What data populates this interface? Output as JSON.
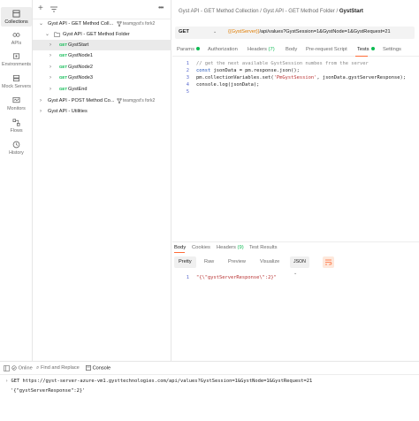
{
  "rail": [
    {
      "label": "Collections",
      "icon": "collections-icon",
      "active": true
    },
    {
      "label": "APIs",
      "icon": "apis-icon"
    },
    {
      "label": "Environments",
      "icon": "environments-icon"
    },
    {
      "label": "Mock Servers",
      "icon": "mock-servers-icon"
    },
    {
      "label": "Monitors",
      "icon": "monitors-icon"
    },
    {
      "label": "Flows",
      "icon": "flows-icon"
    },
    {
      "label": "History",
      "icon": "history-icon"
    }
  ],
  "sidebar": {
    "tree": [
      {
        "label": "Gyst API - GET Method Coll...",
        "fork": "teamgyst's fork2"
      },
      {
        "label": "Gyst API - GET Method Folder"
      },
      {
        "method": "GET",
        "label": "GystStart"
      },
      {
        "method": "GET",
        "label": "GystNode1"
      },
      {
        "method": "GET",
        "label": "GystNode2"
      },
      {
        "method": "GET",
        "label": "GystNode3"
      },
      {
        "method": "GET",
        "label": "GystEnd"
      },
      {
        "label": "Gyst API - POST Method Co...",
        "fork": "teamgyst's fork2"
      },
      {
        "label": "Gyst API - Utilities"
      }
    ]
  },
  "breadcrumb": {
    "part1": "Gyst API - GET Method Collection",
    "sep": "/",
    "part2": "Gyst API - GET Method Folder",
    "current": "GystStart"
  },
  "request": {
    "method": "GET",
    "url_var": "{{GystServer}}",
    "url_rest": "/api/values?GystSession=1&GystNode=1&GystRequest=21"
  },
  "tabs": {
    "params": "Params",
    "authorization": "Authorization",
    "headers": "Headers",
    "headers_count": "(7)",
    "body": "Body",
    "prerequest": "Pre-request Script",
    "tests": "Tests",
    "settings": "Settings"
  },
  "code_lines": [
    {
      "n": "1",
      "text": "// get the next available GystSession numbes from the server"
    },
    {
      "n": "2",
      "kw": "const",
      "text": " jsonData = pm.response.json();"
    },
    {
      "n": "3",
      "pre": "pm.collectionVariables.set(",
      "str": "'PmGystSession'",
      "post": ", jsonData.gystServerResponse);"
    },
    {
      "n": "4",
      "text": "console.log(jsonData);"
    },
    {
      "n": "5",
      "text": ""
    }
  ],
  "response": {
    "tabs": {
      "body": "Body",
      "cookies": "Cookies",
      "headers": "Headers",
      "headers_count": "(9)",
      "test_results": "Test Results"
    },
    "format_buttons": [
      "Pretty",
      "Raw",
      "Preview",
      "Visualize"
    ],
    "format": "JSON",
    "line_no": "1",
    "body": "\"{\\\"gystServerResponse\\\":2}\""
  },
  "footer": {
    "online": "Online",
    "find_replace": "Find and Replace",
    "console": "Console"
  },
  "console": {
    "method": "GET",
    "url": "https://gyst-server-azure-vm1.gysttechnologies.com/api/values?GystSession=1&GystNode=1&GystRequest=21",
    "log": "'{\"gystServerResponse\":2}'"
  },
  "colors": {
    "accent": "#ff6c37",
    "get_method": "#0cbb52",
    "variable": "#e07c00"
  }
}
